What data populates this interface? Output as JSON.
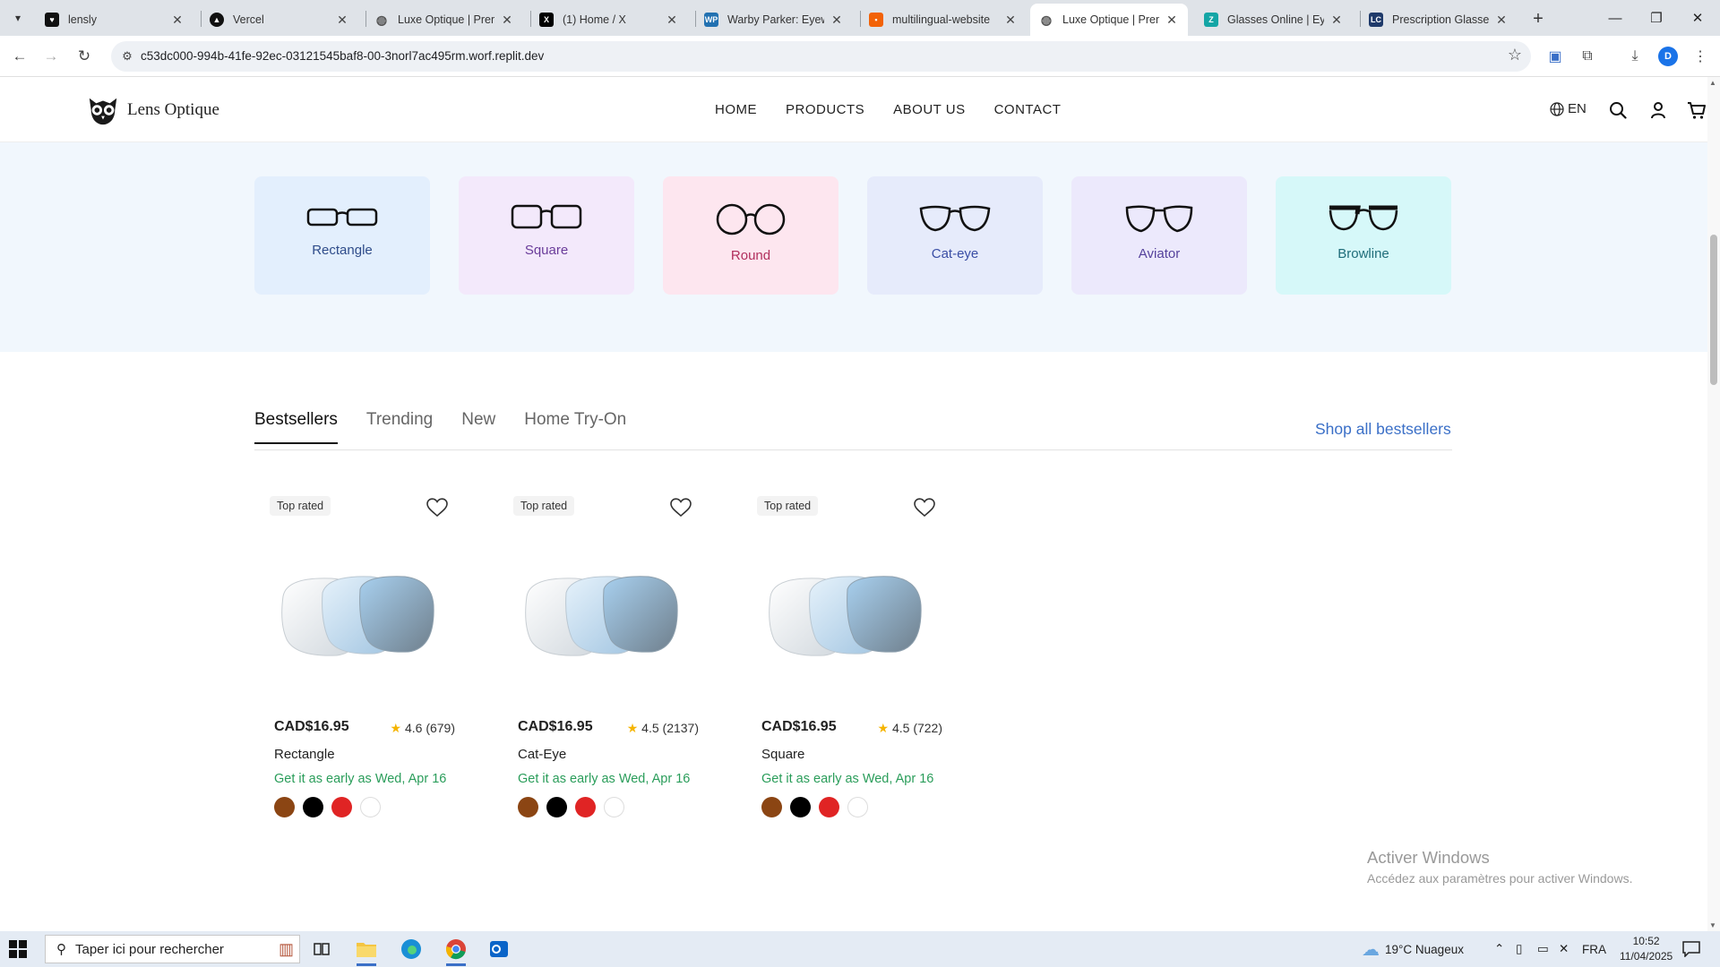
{
  "browser": {
    "tabs": [
      {
        "label": "lensly",
        "favicon": "heart-icon",
        "active": false
      },
      {
        "label": "Vercel",
        "favicon": "vercel-icon",
        "active": false
      },
      {
        "label": "Luxe Optique | Premi",
        "favicon": "globe-icon",
        "active": false
      },
      {
        "label": "(1) Home / X",
        "favicon": "x-icon",
        "active": false
      },
      {
        "label": "Warby Parker: Eyewe",
        "favicon": "wp-icon",
        "active": false
      },
      {
        "label": "multilingual-website",
        "favicon": "replit-icon",
        "active": false
      },
      {
        "label": "Luxe Optique | Premi",
        "favicon": "globe-icon",
        "active": true
      },
      {
        "label": "Glasses Online | Eyew",
        "favicon": "zenni-icon",
        "active": false
      },
      {
        "label": "Prescription Glasses,",
        "favicon": "lc-icon",
        "active": false
      }
    ],
    "url": "c53dc000-994b-41fe-92ec-03121545baf8-00-3norl7ac495rm.worf.replit.dev",
    "profile_initial": "D"
  },
  "site": {
    "brand": "Lens Optique",
    "nav": [
      "HOME",
      "PRODUCTS",
      "ABOUT US",
      "CONTACT"
    ],
    "language": "EN",
    "cart_count": "0"
  },
  "shapes": [
    {
      "label": "Rectangle",
      "bg": "#e3effd",
      "color": "#2f4c8a"
    },
    {
      "label": "Square",
      "bg": "#f3e9fb",
      "color": "#6a3c9a"
    },
    {
      "label": "Round",
      "bg": "#fde6ef",
      "color": "#b12f5d"
    },
    {
      "label": "Cat-eye",
      "bg": "#e6ebfb",
      "color": "#3a4ea5"
    },
    {
      "label": "Aviator",
      "bg": "#ece9fc",
      "color": "#55429c"
    },
    {
      "label": "Browline",
      "bg": "#d6f8f9",
      "color": "#1f6d7a"
    }
  ],
  "product_tabs": [
    "Bestsellers",
    "Trending",
    "New",
    "Home Try-On"
  ],
  "shop_all": "Shop all bestsellers",
  "products": [
    {
      "badge": "Top rated",
      "price": "CAD$16.95",
      "rating": "4.6",
      "reviews": "(679)",
      "name": "Rectangle",
      "delivery": "Get it as early as Wed, Apr 16"
    },
    {
      "badge": "Top rated",
      "price": "CAD$16.95",
      "rating": "4.5",
      "reviews": "(2137)",
      "name": "Cat-Eye",
      "delivery": "Get it as early as Wed, Apr 16"
    },
    {
      "badge": "Top rated",
      "price": "CAD$16.95",
      "rating": "4.5",
      "reviews": "(722)",
      "name": "Square",
      "delivery": "Get it as early as Wed, Apr 16"
    }
  ],
  "swatch_colors": [
    "#8b4513",
    "#000000",
    "#e02424",
    "#ffffff"
  ],
  "watermark": {
    "title": "Activer Windows",
    "subtitle": "Accédez aux paramètres pour activer Windows."
  },
  "taskbar": {
    "search_placeholder": "Taper ici pour rechercher",
    "weather": "19°C  Nuageux",
    "language": "FRA",
    "time": "10:52",
    "date": "11/04/2025"
  }
}
